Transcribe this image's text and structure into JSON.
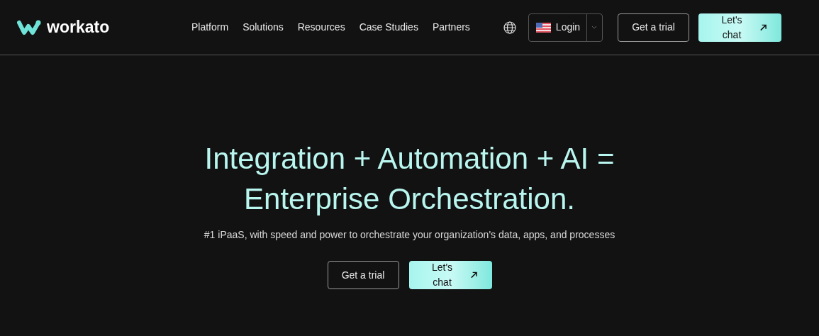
{
  "header": {
    "logo": "workato",
    "nav": [
      "Platform",
      "Solutions",
      "Resources",
      "Case Studies",
      "Partners"
    ],
    "login": "Login",
    "trial_button": "Get a trial",
    "chat_button": "Let's chat"
  },
  "hero": {
    "title_lines": [
      "Integration + Automation + AI =",
      "Enterprise Orchestration."
    ],
    "subtitle": "#1 iPaaS, with speed and power to orchestrate your organization's data, apps, and processes",
    "trial_button": "Get a trial",
    "chat_button": "Let's chat"
  }
}
